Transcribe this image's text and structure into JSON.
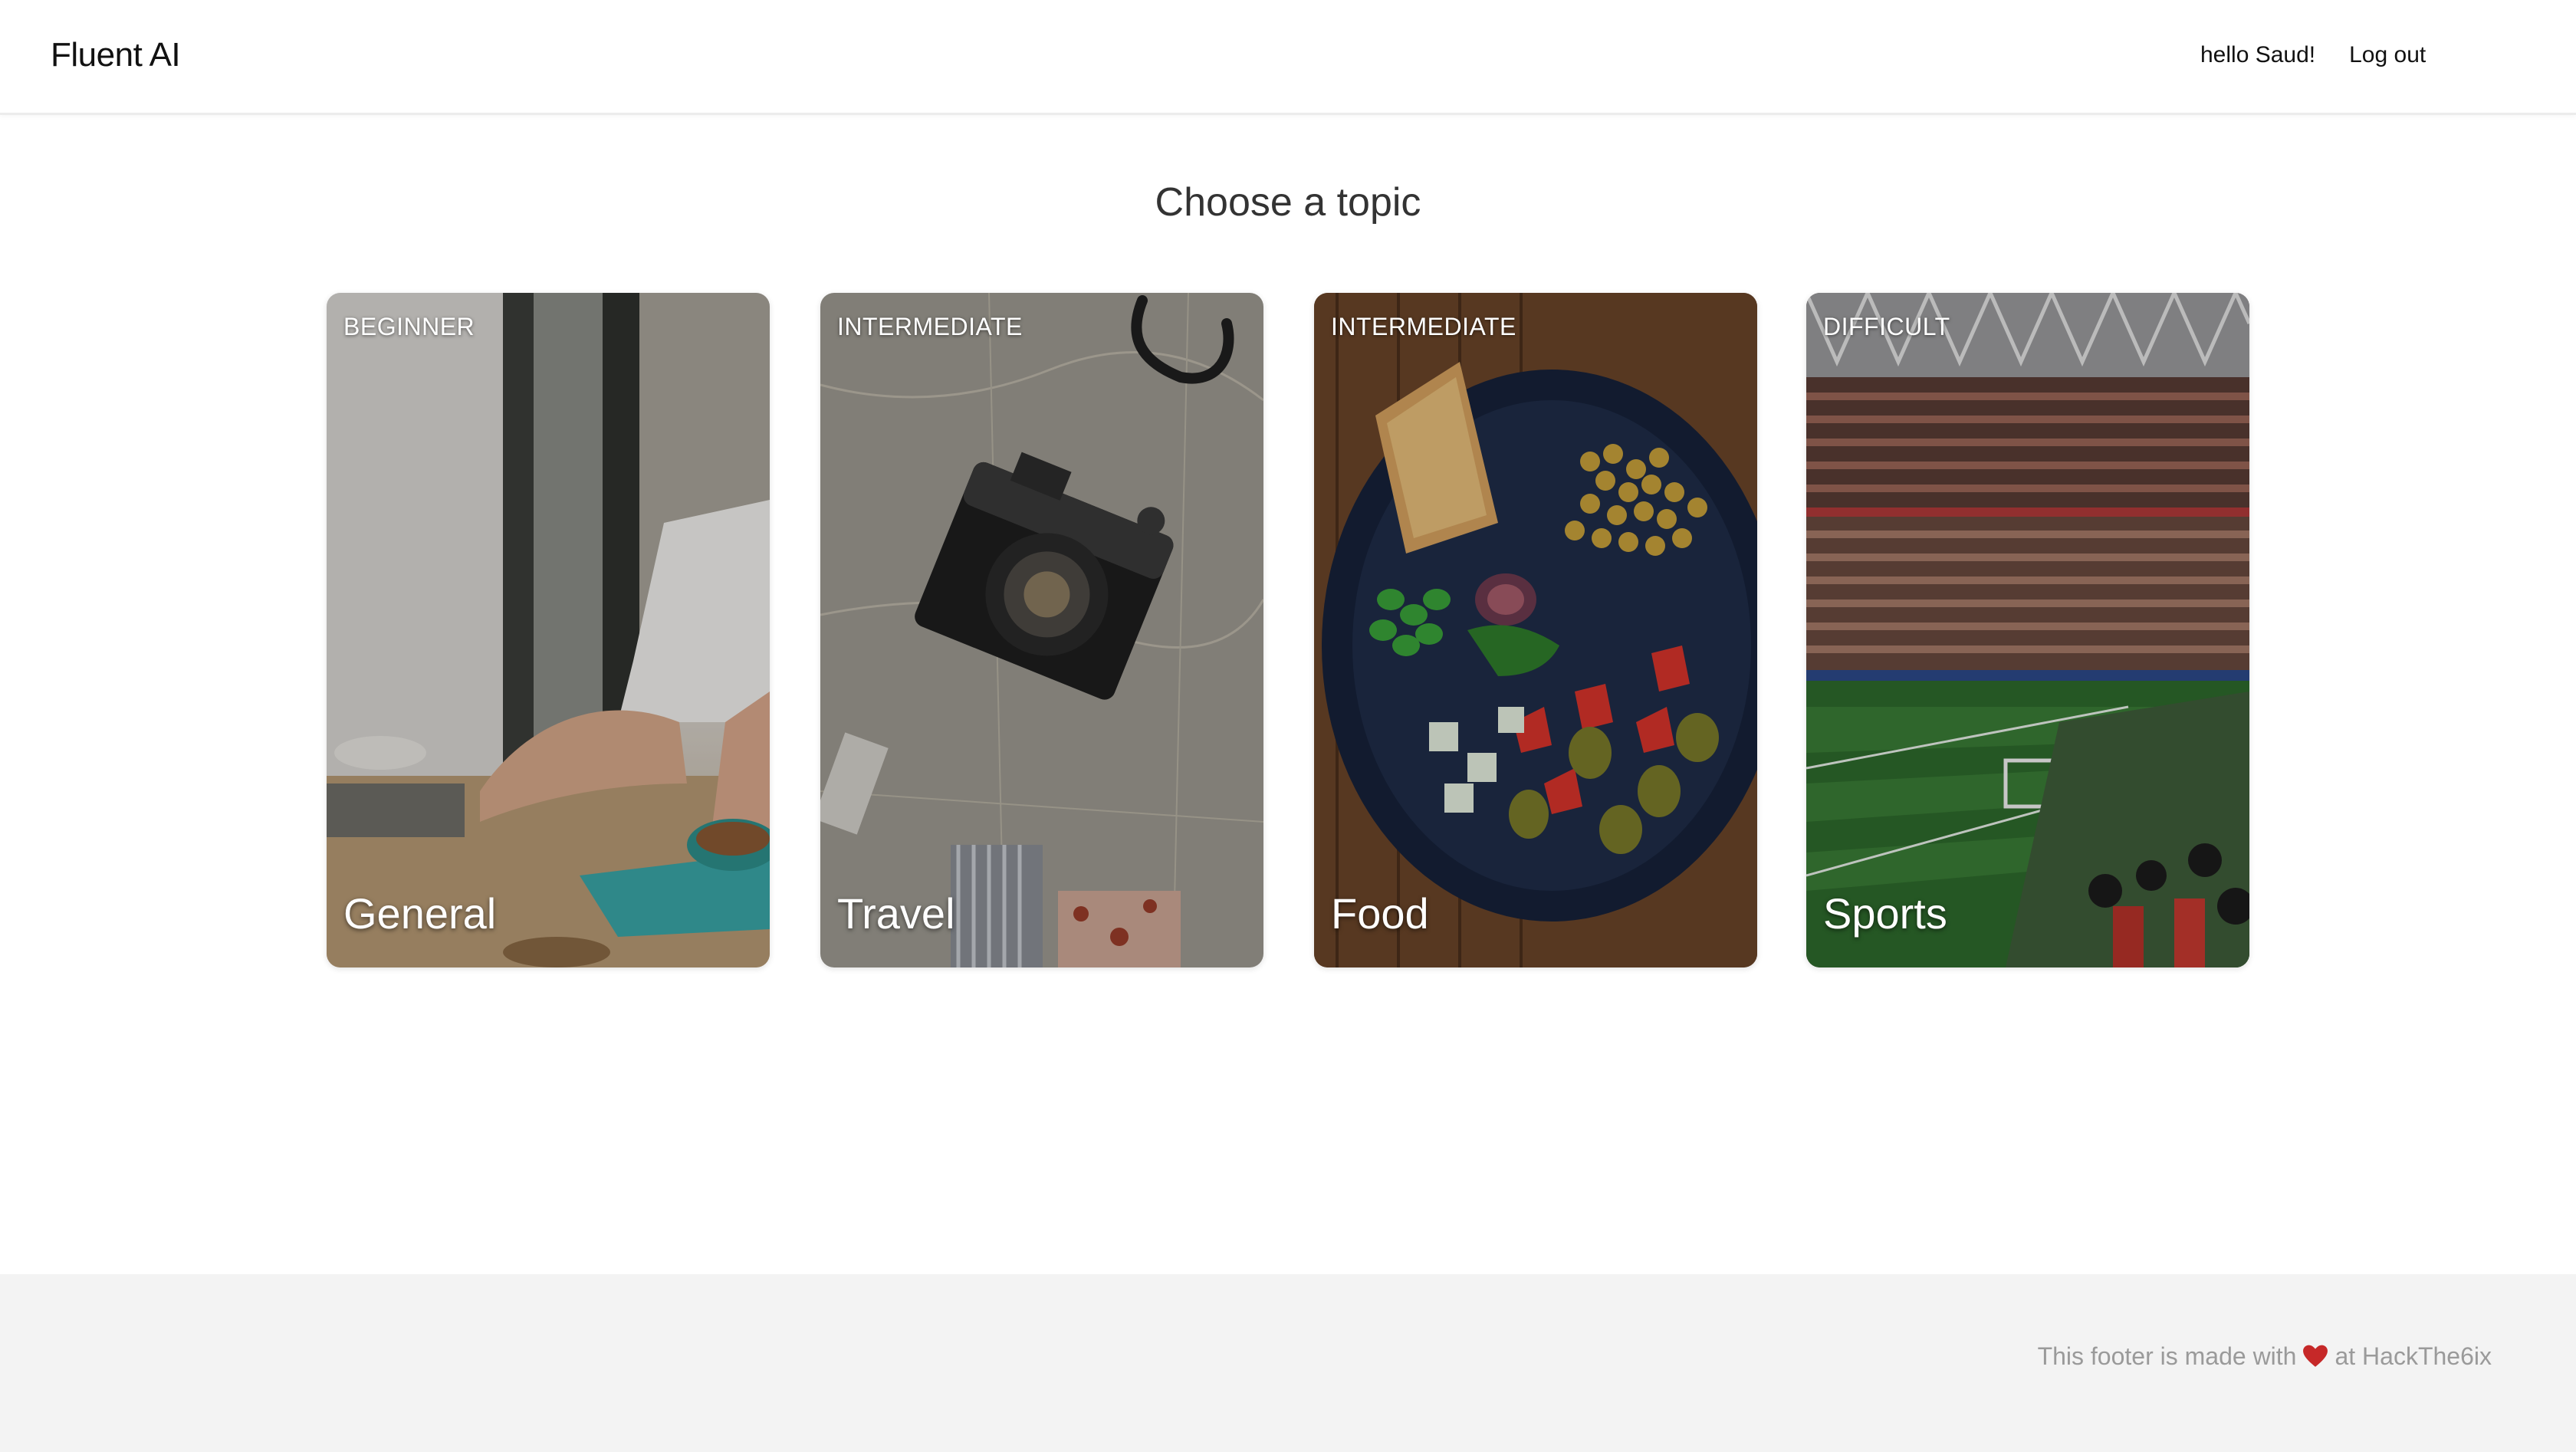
{
  "header": {
    "brand": "Fluent AI",
    "greeting": "hello Saud!",
    "logout_label": "Log out"
  },
  "main": {
    "title": "Choose a topic",
    "topics": [
      {
        "level": "BEGINNER",
        "name": "General"
      },
      {
        "level": "INTERMEDIATE",
        "name": "Travel"
      },
      {
        "level": "INTERMEDIATE",
        "name": "Food"
      },
      {
        "level": "DIFFICULT",
        "name": "Sports"
      }
    ]
  },
  "footer": {
    "text_before": "This footer is made with",
    "text_after": "at HackThe6ix",
    "heart_icon": "heart-icon",
    "heart_color": "#c62828"
  }
}
